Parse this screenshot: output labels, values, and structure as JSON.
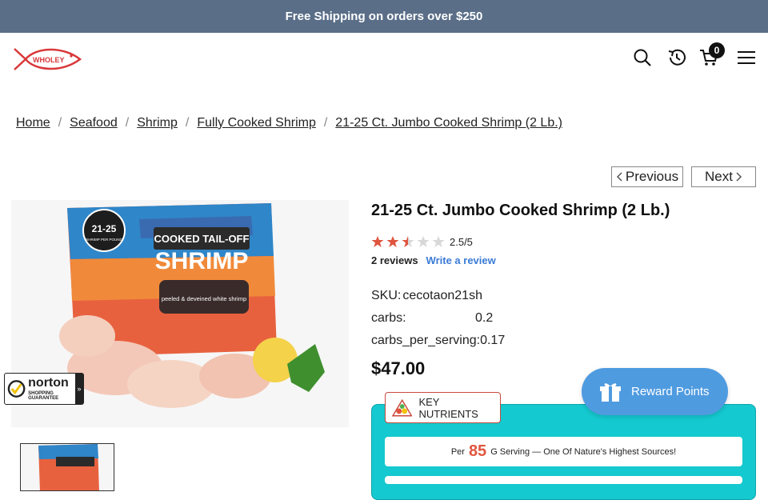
{
  "announcement": "Free Shipping on orders over $250",
  "header": {
    "logo_text": "WHOLEY",
    "cart_count": "0",
    "icons": [
      "search-icon",
      "history-icon",
      "cart-icon",
      "menu-icon"
    ]
  },
  "breadcrumb": [
    "Home",
    "Seafood",
    "Shrimp",
    "Fully Cooked Shrimp",
    "21-25 Ct. Jumbo Cooked Shrimp (2 Lb.)"
  ],
  "nav": {
    "previous": "Previous",
    "next": "Next"
  },
  "product": {
    "title": "21-25 Ct. Jumbo Cooked Shrimp (2 Lb.)",
    "rating_value": 2.5,
    "rating_max": 5,
    "rating_text": "2.5/5",
    "reviews_count": "2 reviews",
    "write_review": "Write a review",
    "specs": [
      {
        "label": "SKU:",
        "value": "cecotaon21sh"
      },
      {
        "label": "carbs:",
        "value": "0.2"
      },
      {
        "label": "carbs_per_serving:",
        "value": "0.17"
      }
    ],
    "price": "$47.00",
    "image_bag_text": {
      "count": "21-25",
      "count_sub": "SHRIMP PER POUND",
      "line1": "COOKED TAIL-OFF",
      "line2": "SHRIMP",
      "line3": "peeled & deveined white shrimp"
    }
  },
  "nutrients": {
    "tab_label": "KEY NUTRIENTS",
    "serving_prefix": "Per",
    "serving_grams": "85",
    "serving_suffix": "G Serving — One Of Nature's Highest Sources!"
  },
  "norton": {
    "brand": "norton",
    "sub": "SHOPPING GUARANTEE"
  },
  "reward": {
    "label": "Reward Points"
  },
  "colors": {
    "announce_bg": "#5a6e88",
    "accent_teal": "#14c9cf",
    "reward_blue": "#4f9be0",
    "star": "#e0553f",
    "logo_red": "#d9383a"
  }
}
